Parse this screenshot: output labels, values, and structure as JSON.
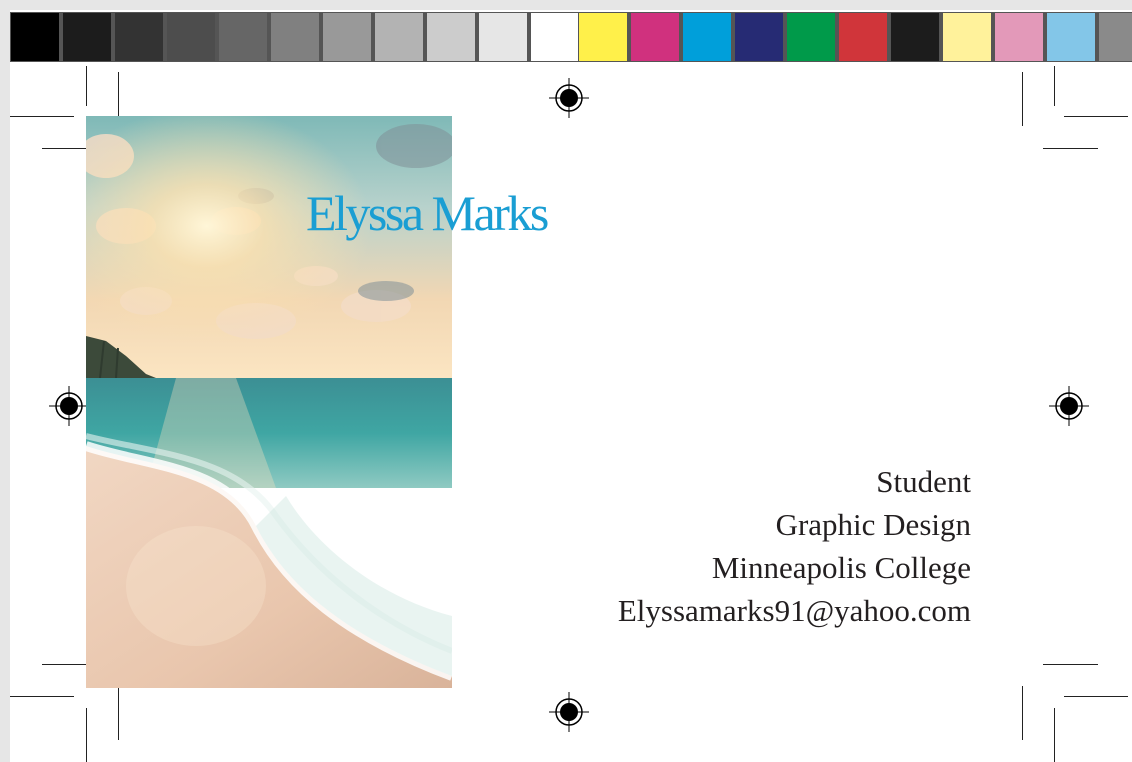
{
  "card": {
    "name": "Elyssa Marks",
    "name_color": "#1a9ed3",
    "details": {
      "role": "Student",
      "program": "Graphic Design",
      "school": "Minneapolis College",
      "email": "Elyssamarks91@yahoo.com"
    },
    "photo": "beach-sunset-photo"
  },
  "color_bar": {
    "grays": [
      "#000000",
      "#1c1c1c",
      "#333333",
      "#4d4d4d",
      "#666666",
      "#808080",
      "#999999",
      "#b3b3b3",
      "#cccccc",
      "#e6e6e6",
      "#ffffff"
    ],
    "colors": [
      "#fff04a",
      "#d0317e",
      "#009fda",
      "#262b74",
      "#009a4a",
      "#d0353a",
      "#1c1c1c",
      "#fff29b",
      "#e399b9",
      "#83c6e8",
      "#8a8a8a"
    ]
  },
  "marks": {
    "registration_icon": "registration-target-icon",
    "crop_icon": "crop-mark"
  }
}
